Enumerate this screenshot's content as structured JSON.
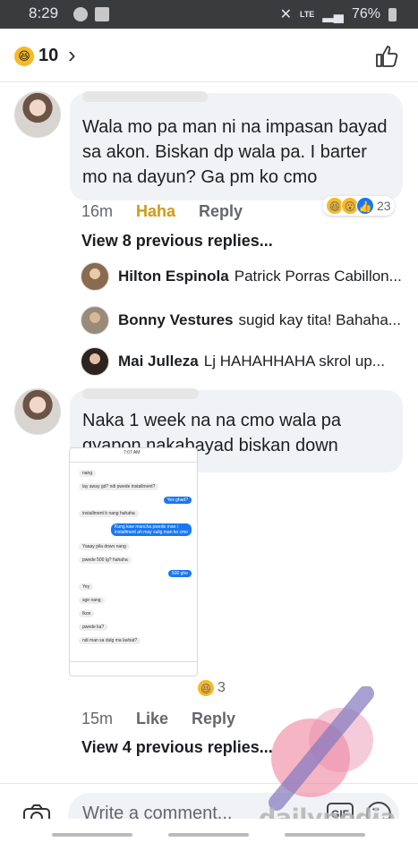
{
  "status_bar": {
    "time": "8:29",
    "network": "LTE",
    "battery": "76%"
  },
  "header": {
    "reaction_count": "10"
  },
  "comments": [
    {
      "text": "Wala mo pa man ni na impasan bayad sa akon. Biskan dp wala pa. I barter mo na dayun? Ga pm ko cmo",
      "time": "16m",
      "reaction_label": "Haha",
      "reply_label": "Reply",
      "reaction_count": "23",
      "view_replies": "View 8 previous replies...",
      "replies": [
        {
          "name": "Hilton Espinola",
          "text": "Patrick Porras Cabillon..."
        },
        {
          "name": "Bonny Vestures",
          "text": "sugid kay tita! Bahaha..."
        },
        {
          "name": "Mai Julleza",
          "text": "Lj HAHAHHAHA skrol up..."
        }
      ]
    },
    {
      "text": "Naka 1 week na na cmo wala pa gyapon nakabayad biskan down",
      "time": "15m",
      "reaction_label": "Like",
      "reply_label": "Reply",
      "reaction_count": "3",
      "view_replies": "View 4 previous replies..."
    }
  ],
  "chat_screenshot": {
    "time": "7:07 AM",
    "messages": [
      {
        "from": "them",
        "text": "nang"
      },
      {
        "from": "them",
        "text": "lay away gd? ndi pwede installment?"
      },
      {
        "from": "me",
        "text": "Yes ghad?"
      },
      {
        "from": "them",
        "text": "installment b nang hahaha"
      },
      {
        "from": "me",
        "text": "Kung kaw mancha pwede man i installment ah may sulig man ko cmo"
      },
      {
        "from": "them",
        "text": "Yaaay pila down nang"
      },
      {
        "from": "them",
        "text": "pwede 500 lg? hahaha"
      },
      {
        "from": "me",
        "text": "500 ghe"
      },
      {
        "from": "them",
        "text": "Yey"
      },
      {
        "from": "them",
        "text": "sge nang"
      },
      {
        "from": "them",
        "text": "Ikon"
      },
      {
        "from": "them",
        "text": "pwede ka?"
      },
      {
        "from": "them",
        "text": "ndi man sa dulg ma lavbat?"
      }
    ]
  },
  "composer": {
    "placeholder": "Write a comment...",
    "gif_label": "GIF"
  },
  "watermark": {
    "text": "dailypedia"
  },
  "colors": {
    "haha": "#d29a10",
    "bubble": "#f0f2f5",
    "accent": "#1877f2"
  }
}
